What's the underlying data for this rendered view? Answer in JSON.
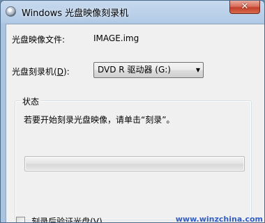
{
  "window": {
    "title": "Windows 光盘映像刻录机",
    "close_label": "✕"
  },
  "image_file": {
    "label": "光盘映像文件:",
    "value": "IMAGE.img"
  },
  "burner": {
    "label_prefix": "光盘刻录机(",
    "label_hotkey": "D",
    "label_suffix": "):",
    "selected": "DVD R 驱动器 (G:)",
    "arrow": "▼"
  },
  "status_group": {
    "title": "状态",
    "instruction": "若要开始刻录光盘映像，请单击“刻录”。",
    "progress": 0
  },
  "verify": {
    "label": "刻录后验证光盘(V)",
    "checked": false
  },
  "watermark": "www.winzchina.com",
  "colors": {
    "title_bar": "#b3cbe6",
    "client_bg": "#f0f0f0",
    "close_red": "#c2402b",
    "watermark": "#1f4fbf"
  }
}
